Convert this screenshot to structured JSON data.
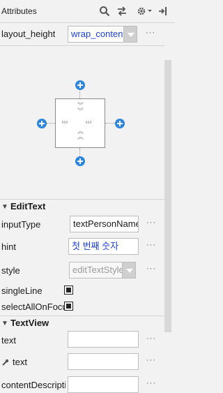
{
  "header": {
    "title": "Attributes",
    "icons": [
      "search-icon",
      "swap-icon",
      "gear-icon",
      "pin-icon"
    ]
  },
  "top": {
    "layout_height_label": "layout_height",
    "layout_height_value": "wrap_content",
    "more": "···"
  },
  "edittext": {
    "title": "EditText",
    "input_type_label": "inputType",
    "input_type_value": "textPersonName",
    "hint_label": "hint",
    "hint_value": "첫 번째 숫자",
    "style_label": "style",
    "style_value": "editTextStyle",
    "single_line_label": "singleLine",
    "select_all_label": "selectAllOnFocus",
    "more": "···"
  },
  "textview": {
    "title": "TextView",
    "text_label": "text",
    "text_tools_label": "text",
    "content_desc_label": "contentDescription",
    "more": "···"
  },
  "colors": {
    "accent_blue": "#1c3fd6",
    "plus_blue": "#2e86de"
  }
}
